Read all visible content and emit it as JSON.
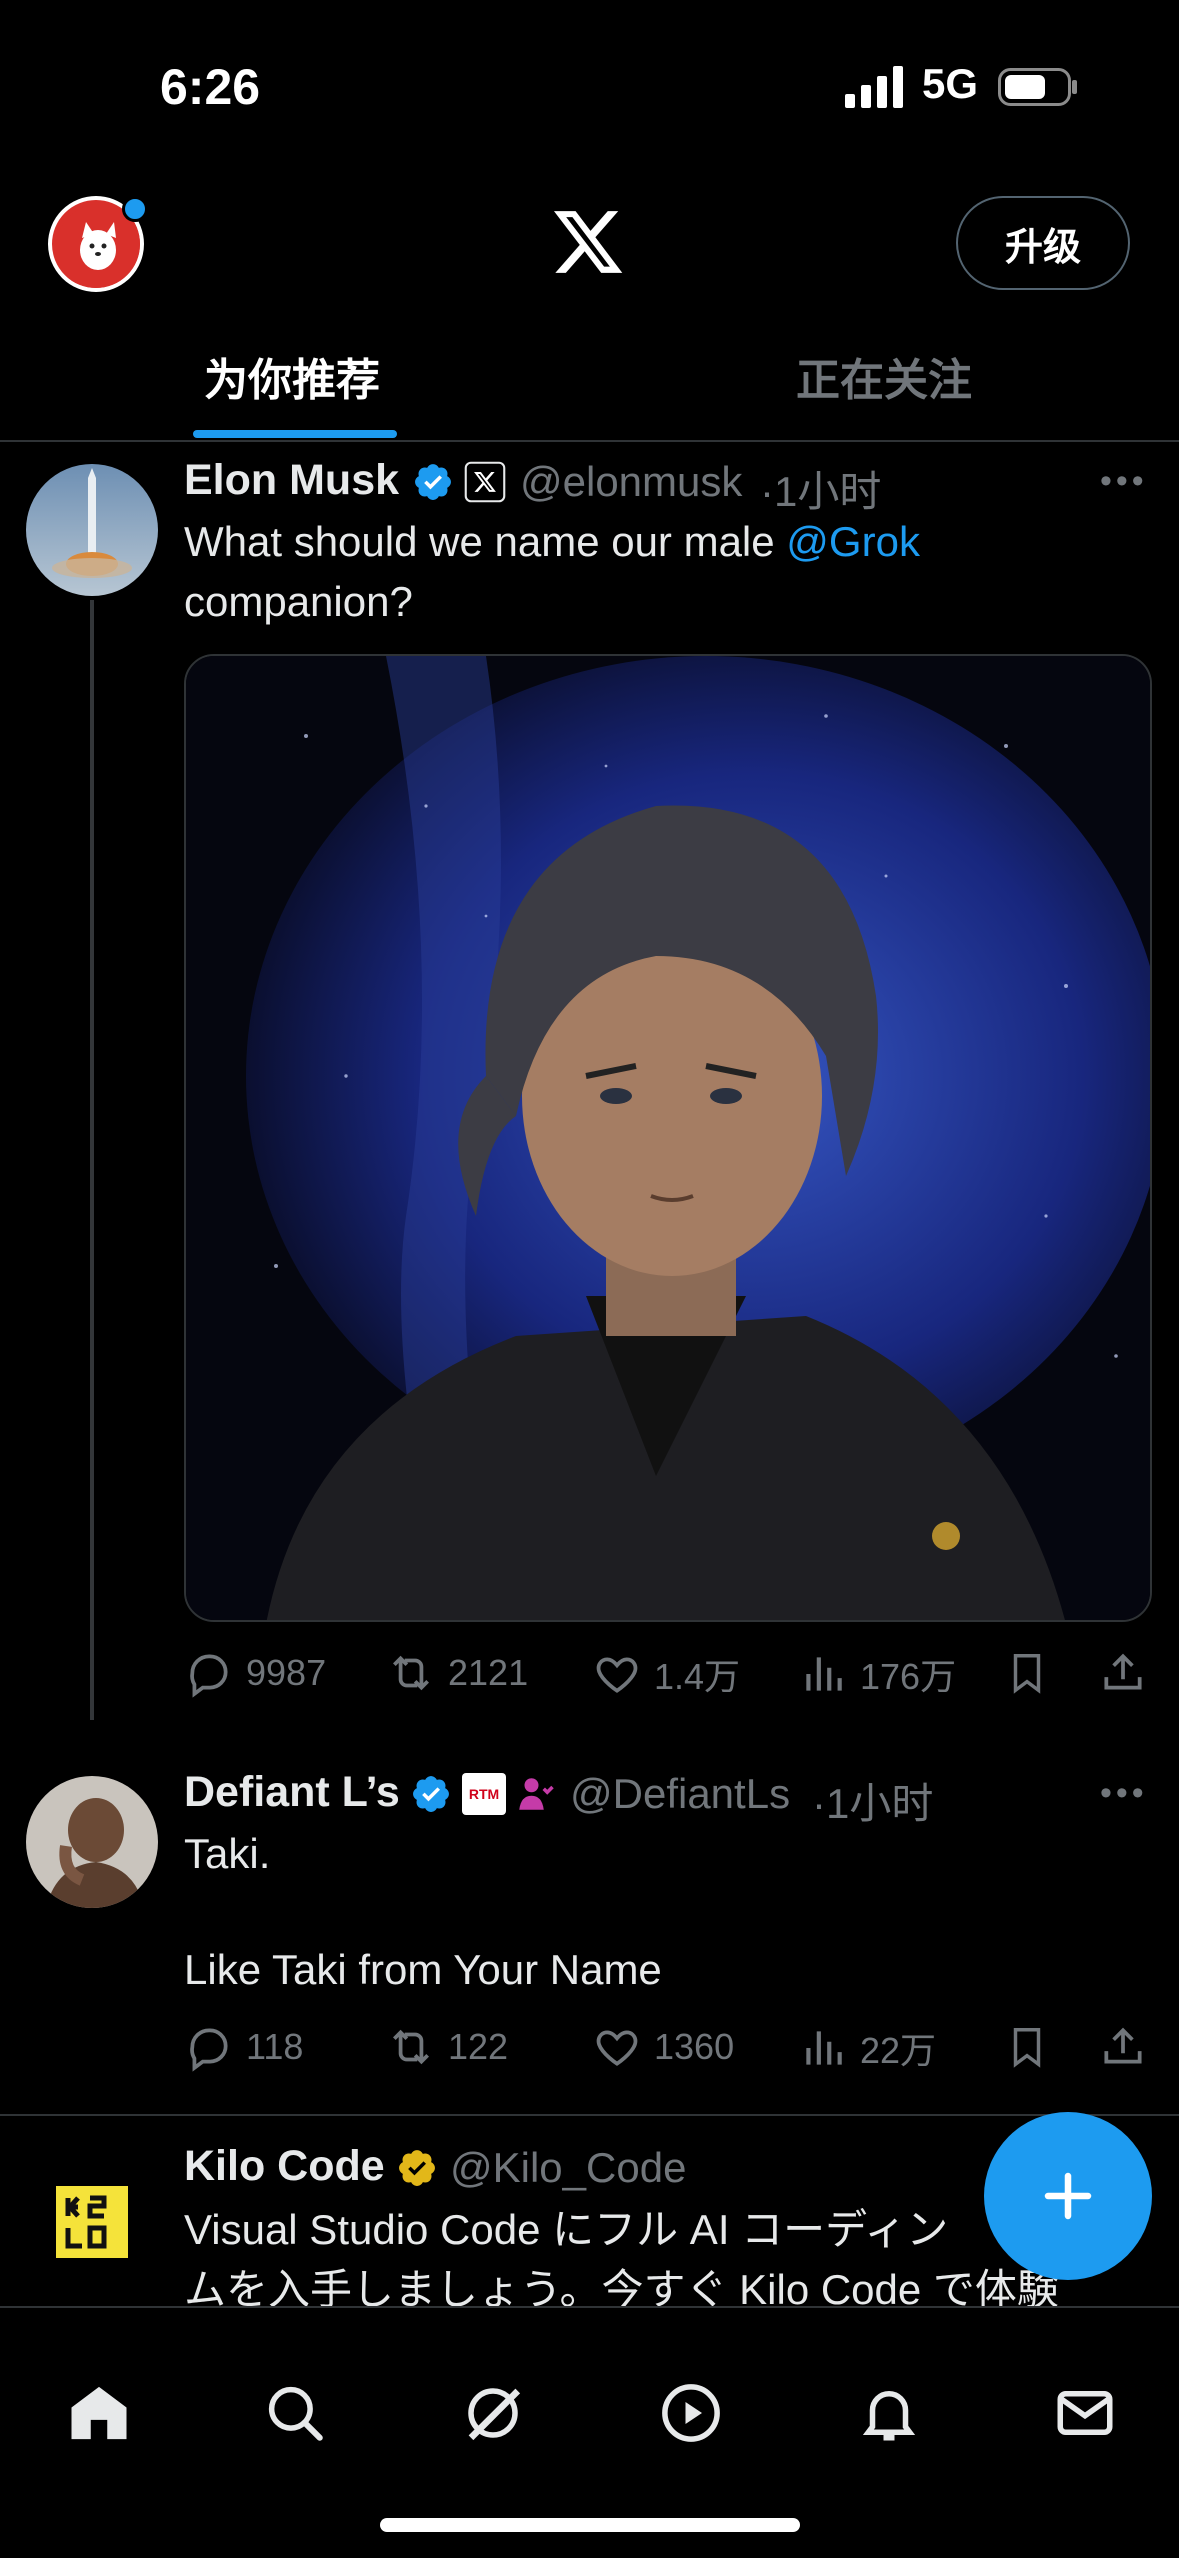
{
  "status": {
    "time": "6:26",
    "network": "5G"
  },
  "header": {
    "upgrade_label": "升级"
  },
  "tabs": [
    {
      "label": "为你推荐",
      "active": true
    },
    {
      "label": "正在关注",
      "active": false
    }
  ],
  "tweets": [
    {
      "name": "Elon Musk",
      "handle": "@elonmusk",
      "time": "·1小时",
      "text_before": "What should we name our male ",
      "mention": "@Grok",
      "text_after": "companion?",
      "stats": {
        "replies": "9987",
        "retweets": "2121",
        "likes": "1.4万",
        "views": "176万"
      }
    },
    {
      "name": "Defiant L’s",
      "handle": "@DefiantLs",
      "time": "·1小时",
      "badge_text": "RTM",
      "line1": "Taki.",
      "line2": "Like Taki from Your Name",
      "stats": {
        "replies": "118",
        "retweets": "122",
        "likes": "1360",
        "views": "22万"
      }
    },
    {
      "name": "Kilo Code",
      "handle": "@Kilo_Code",
      "line1": "Visual Studio Code にフル AI コーディン",
      "line2": "ムを入手しましょう。今すぐ Kilo Code で体験"
    }
  ],
  "colors": {
    "accent": "#1d9bf0",
    "verified_gold": "#e2b719",
    "background": "#000000",
    "muted": "#71767b"
  }
}
